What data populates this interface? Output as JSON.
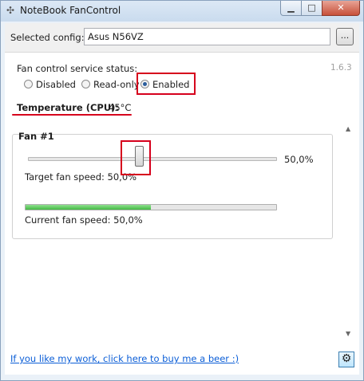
{
  "window": {
    "title": "NoteBook FanControl",
    "app_icon": "fan-icon",
    "minimize_glyph": "▁",
    "maximize_glyph": "□",
    "close_glyph": "✕"
  },
  "config": {
    "label": "Selected config:",
    "value": "Asus N56VZ",
    "browse_label": "..."
  },
  "service": {
    "title": "Fan control service status:",
    "version": "1.6.3",
    "options": [
      {
        "label": "Disabled",
        "selected": false
      },
      {
        "label": "Read-only",
        "selected": false
      },
      {
        "label": "Enabled",
        "selected": true
      }
    ]
  },
  "temperature": {
    "label": "Temperature (CPU):",
    "value": "45°C"
  },
  "fan": {
    "title": "Fan #1",
    "slider_value": "50,0%",
    "slider_fraction": 0.5,
    "target_text": "Target fan speed:  50,0%",
    "current_text": "Current fan speed:  50,0%",
    "current_fraction": 0.5
  },
  "scrollbar": {
    "up_glyph": "▲",
    "down_glyph": "▼"
  },
  "footer": {
    "link_text": "If you like my work, click here to buy me a beer :)",
    "settings_icon": "gear-icon",
    "settings_glyph": "⚙"
  },
  "colors": {
    "highlight": "#d6001c",
    "progress": "#44b944",
    "link": "#0b5ed7"
  }
}
